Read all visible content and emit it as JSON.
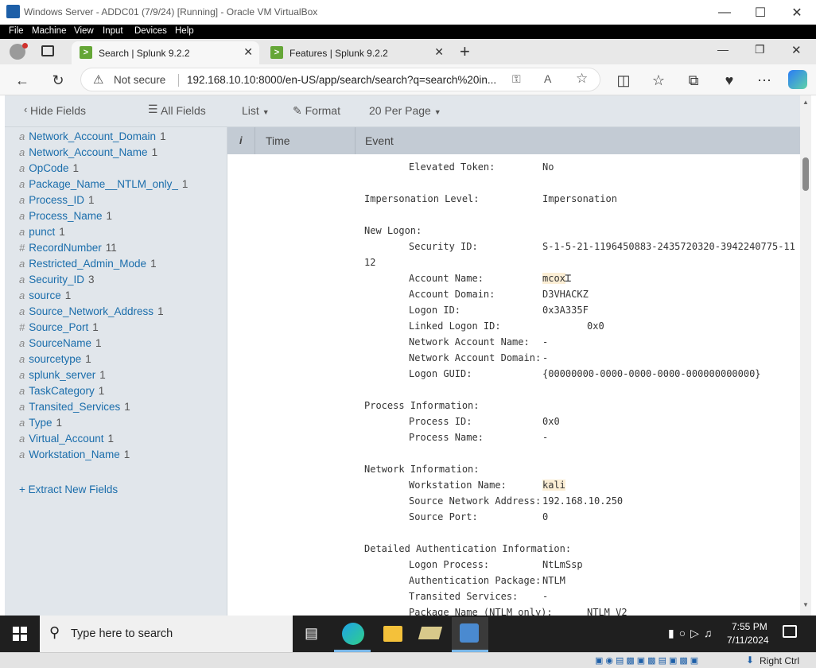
{
  "window": {
    "title": "Windows Server - ADDC01 (7/9/24) [Running] - Oracle VM VirtualBox",
    "menu": [
      "File",
      "Machine",
      "View",
      "Input",
      "Devices",
      "Help"
    ]
  },
  "browser": {
    "tabs": [
      {
        "label": "Search | Splunk 9.2.2",
        "active": true
      },
      {
        "label": "Features | Splunk 9.2.2",
        "active": false
      }
    ],
    "security_label": "Not secure",
    "url": "192.168.10.10:8000/en-US/app/search/search?q=search%20in..."
  },
  "sidebar": {
    "hide_fields": "Hide Fields",
    "all_fields": "All Fields",
    "fields": [
      {
        "type": "a",
        "name": "Network_Account_Domain",
        "count": "1"
      },
      {
        "type": "a",
        "name": "Network_Account_Name",
        "count": "1"
      },
      {
        "type": "a",
        "name": "OpCode",
        "count": "1"
      },
      {
        "type": "a",
        "name": "Package_Name__NTLM_only_",
        "count": "1"
      },
      {
        "type": "a",
        "name": "Process_ID",
        "count": "1"
      },
      {
        "type": "a",
        "name": "Process_Name",
        "count": "1"
      },
      {
        "type": "a",
        "name": "punct",
        "count": "1"
      },
      {
        "type": "#",
        "name": "RecordNumber",
        "count": "11"
      },
      {
        "type": "a",
        "name": "Restricted_Admin_Mode",
        "count": "1"
      },
      {
        "type": "a",
        "name": "Security_ID",
        "count": "3"
      },
      {
        "type": "a",
        "name": "source",
        "count": "1"
      },
      {
        "type": "a",
        "name": "Source_Network_Address",
        "count": "1"
      },
      {
        "type": "#",
        "name": "Source_Port",
        "count": "1"
      },
      {
        "type": "a",
        "name": "SourceName",
        "count": "1"
      },
      {
        "type": "a",
        "name": "sourcetype",
        "count": "1"
      },
      {
        "type": "a",
        "name": "splunk_server",
        "count": "1"
      },
      {
        "type": "a",
        "name": "TaskCategory",
        "count": "1"
      },
      {
        "type": "a",
        "name": "Transited_Services",
        "count": "1"
      },
      {
        "type": "a",
        "name": "Type",
        "count": "1"
      },
      {
        "type": "a",
        "name": "Virtual_Account",
        "count": "1"
      },
      {
        "type": "a",
        "name": "Workstation_Name",
        "count": "1"
      }
    ],
    "extract": "+ Extract New Fields"
  },
  "results": {
    "list_label": "List",
    "format_label": "Format",
    "per_page_label": "20 Per Page",
    "col_info": "i",
    "col_time": "Time",
    "col_event": "Event"
  },
  "event_lines": [
    {
      "i": 1,
      "k": "Elevated Token:",
      "v": "No"
    },
    {
      "i": 0,
      "k": "Impersonation Level:",
      "v": "Impersonation"
    },
    {
      "i": 0,
      "k": "New Logon:",
      "v": ""
    },
    {
      "i": 1,
      "k": "Security ID:",
      "v": "S-1-5-21-1196450883-2435720320-3942240775-11"
    },
    {
      "i": 0,
      "k": "12",
      "v": ""
    },
    {
      "i": 1,
      "k": "Account Name:",
      "v": "mcox",
      "hl": true
    },
    {
      "i": 1,
      "k": "Account Domain:",
      "v": "D3VHACKZ"
    },
    {
      "i": 1,
      "k": "Logon ID:",
      "v": "0x3A335F"
    },
    {
      "i": 1,
      "k": "Linked Logon ID:",
      "v": "0x0",
      "far": true
    },
    {
      "i": 1,
      "k": "Network Account Name:",
      "v": "-"
    },
    {
      "i": 1,
      "k": "Network Account Domain:",
      "v": "-"
    },
    {
      "i": 1,
      "k": "Logon GUID:",
      "v": "{00000000-0000-0000-0000-000000000000}"
    },
    {
      "i": 0,
      "k": "Process Information:",
      "v": ""
    },
    {
      "i": 1,
      "k": "Process ID:",
      "v": "0x0"
    },
    {
      "i": 1,
      "k": "Process Name:",
      "v": "-"
    },
    {
      "i": 0,
      "k": "Network Information:",
      "v": ""
    },
    {
      "i": 1,
      "k": "Workstation Name:",
      "v": "kali",
      "hl": true
    },
    {
      "i": 1,
      "k": "Source Network Address:",
      "v": "192.168.10.250"
    },
    {
      "i": 1,
      "k": "Source Port:",
      "v": "0"
    },
    {
      "i": 0,
      "k": "Detailed Authentication Information:",
      "v": ""
    },
    {
      "i": 1,
      "k": "Logon Process:",
      "v": "NtLmSsp"
    },
    {
      "i": 1,
      "k": "Authentication Package:",
      "v": "NTLM"
    },
    {
      "i": 1,
      "k": "Transited Services:",
      "v": "-"
    },
    {
      "i": 1,
      "k": "Package Name (NTLM only):",
      "v": "NTLM V2",
      "far": true
    }
  ],
  "taskbar": {
    "search_placeholder": "Type here to search",
    "time": "7:55 PM",
    "date": "7/11/2024"
  },
  "vbox_status": {
    "host_key": "Right Ctrl"
  },
  "colors": {
    "splunk_green": "#65a637",
    "field_blue": "#1a6dab",
    "sidebar_bg": "#e1e6eb",
    "highlight": "#fbeed5"
  }
}
